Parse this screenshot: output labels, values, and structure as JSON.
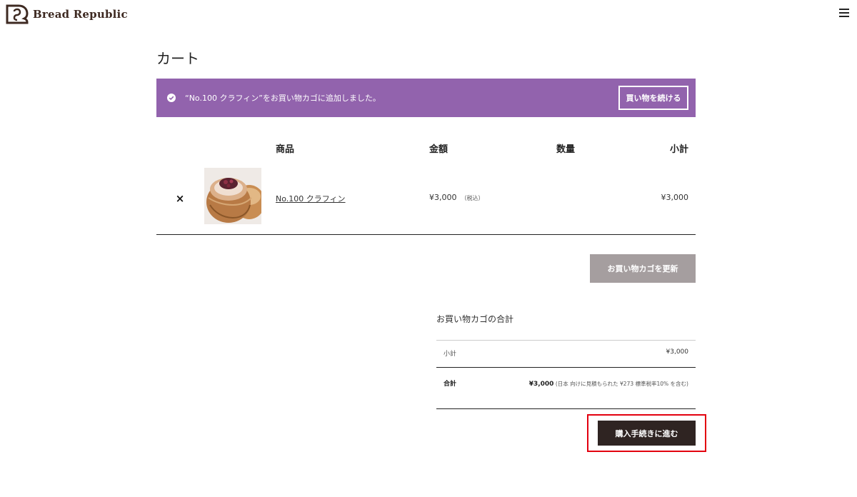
{
  "header": {
    "logo_text": "Bread Republic",
    "brand_color": "#3e2a22"
  },
  "page": {
    "title": "カート"
  },
  "notice": {
    "message": "“No.100 クラフィン”をお買い物カゴに追加しました。",
    "continue_label": "買い物を続ける",
    "background": "#9263ad"
  },
  "cart_table": {
    "headers": {
      "product": "商品",
      "price": "金額",
      "quantity": "数量",
      "subtotal": "小計"
    },
    "items": [
      {
        "remove": "×",
        "name": "No.100 クラフィン",
        "price": "¥3,000",
        "tax_note": "（税込）",
        "subtotal": "¥3,000"
      }
    ],
    "update_label": "お買い物カゴを更新"
  },
  "totals": {
    "title": "お買い物カゴの合計",
    "subtotal_label": "小計",
    "subtotal_value": "¥3,000",
    "total_label": "合計",
    "total_value": "¥3,000",
    "total_note": "(日本 向けに見積もられた ¥273 標準税率10% を含む)"
  },
  "checkout": {
    "label": "購入手続きに進む",
    "highlight_color": "#e3000f"
  }
}
